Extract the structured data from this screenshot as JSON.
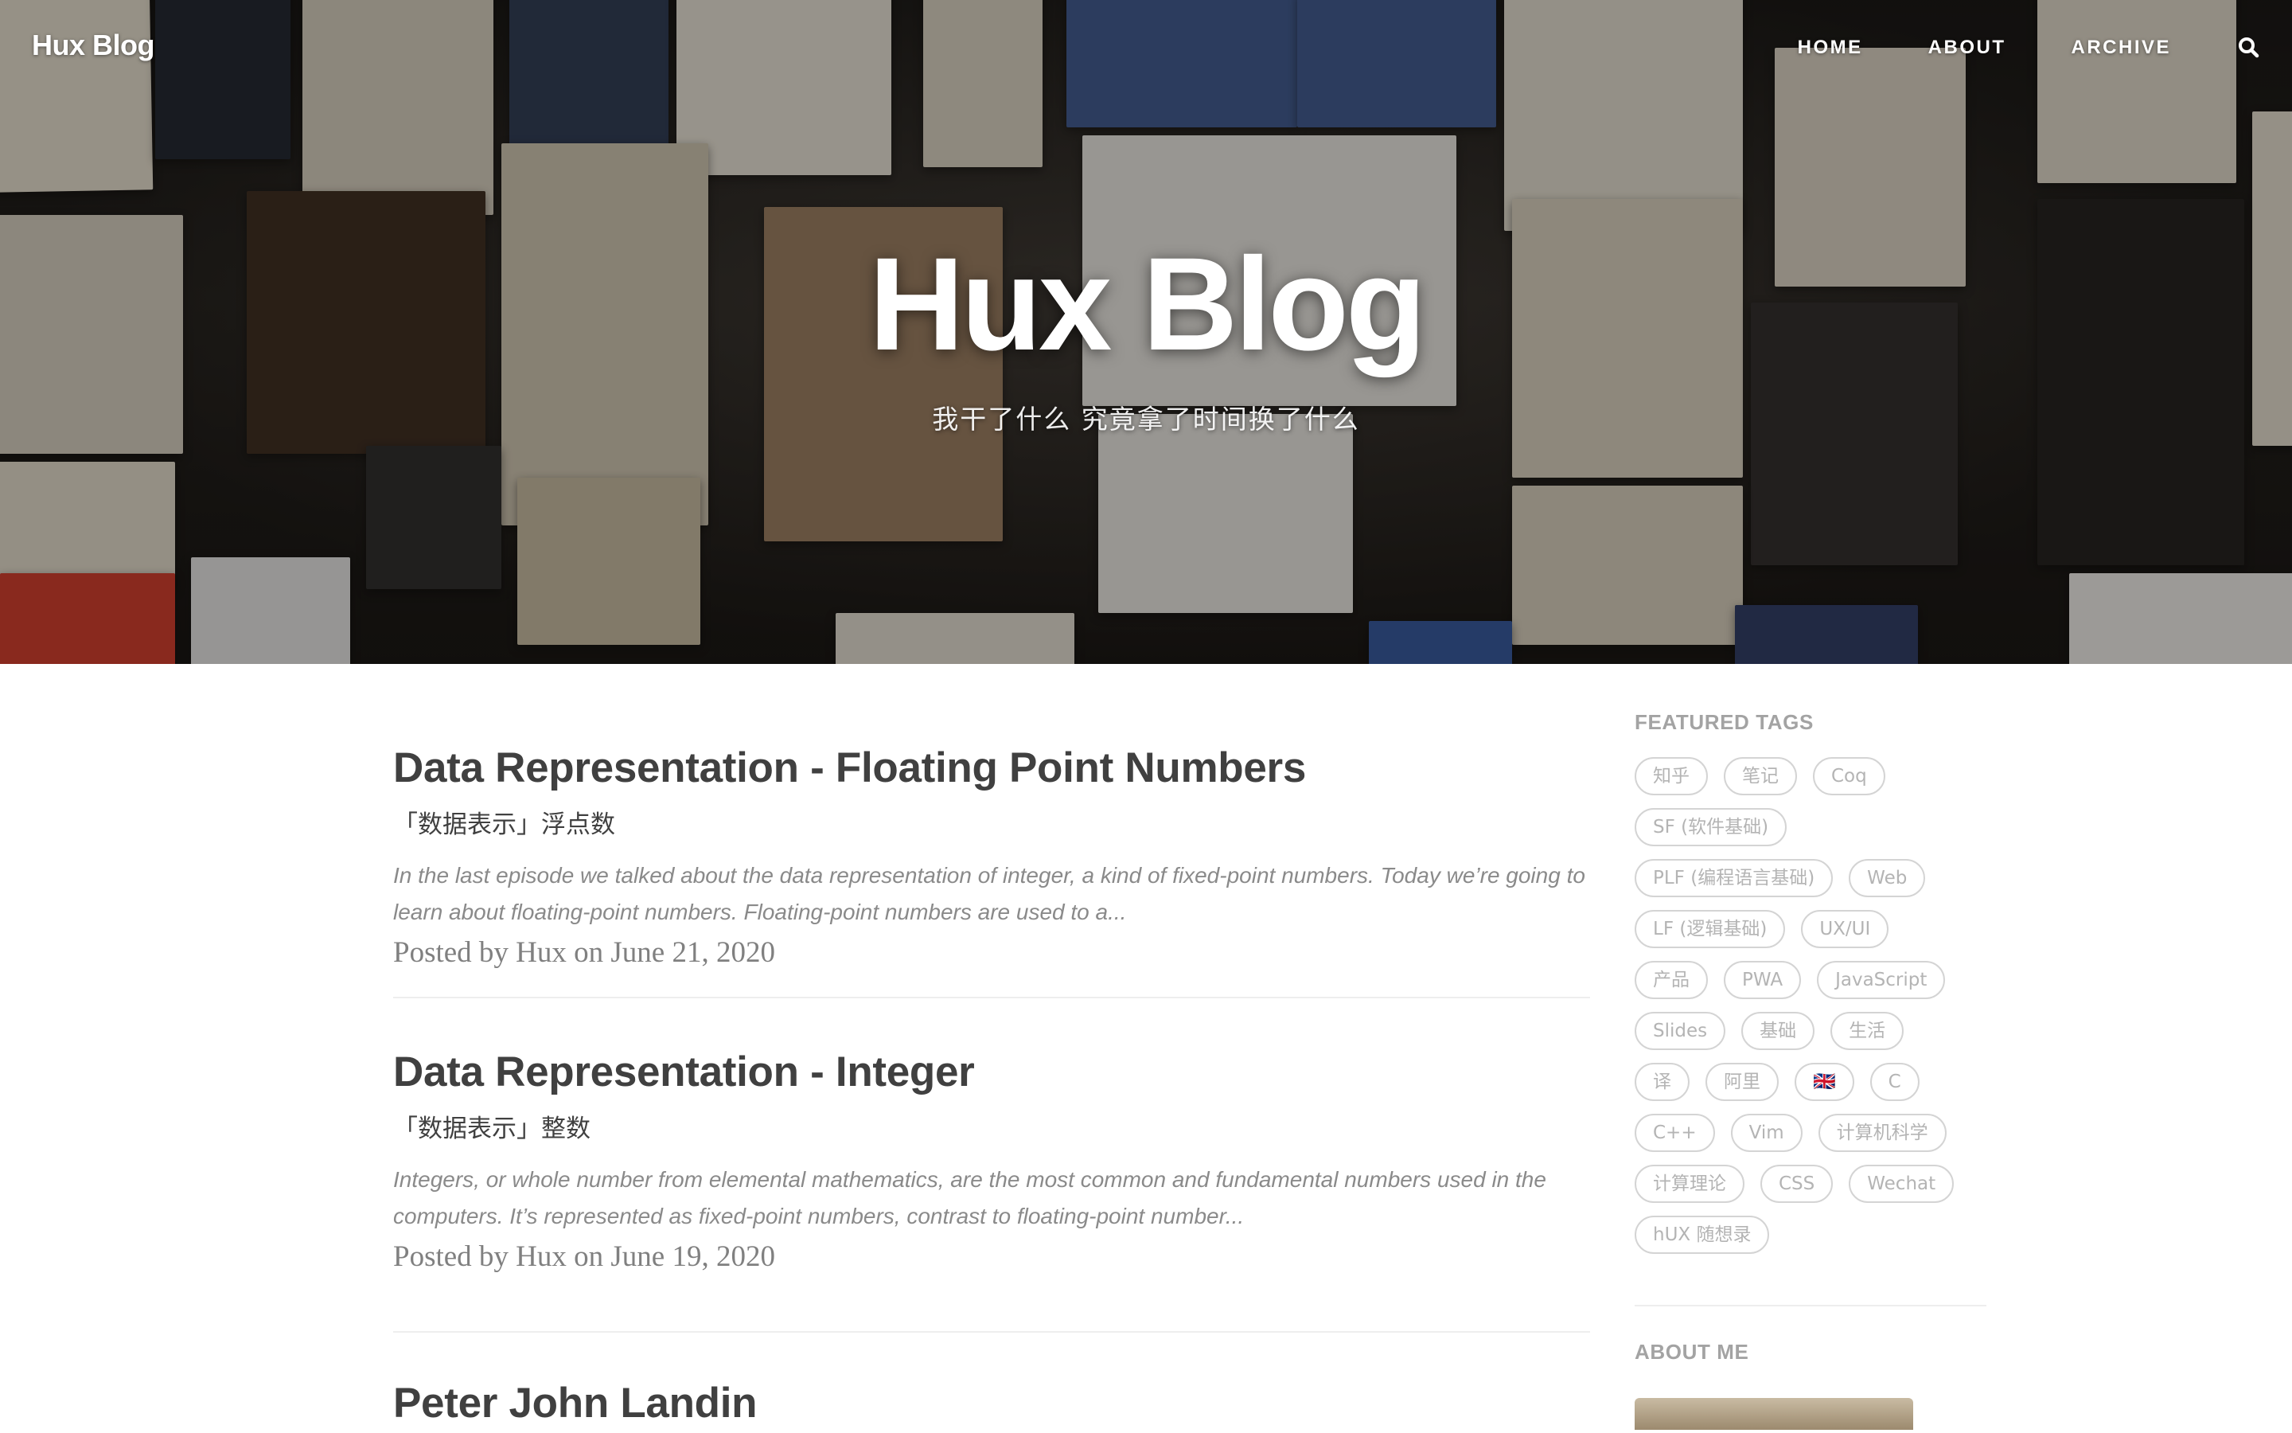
{
  "nav": {
    "brand": "Hux Blog",
    "links": [
      "HOME",
      "ABOUT",
      "ARCHIVE"
    ]
  },
  "hero": {
    "title": "Hux Blog",
    "subtitle": "我干了什么 究竟拿了时间换了什么"
  },
  "posts": [
    {
      "title": "Data Representation - Floating Point Numbers",
      "subtitle": "「数据表示」浮点数",
      "excerpt": "In the last episode we talked about the data representation of integer, a kind of fixed-point numbers. Today we’re going to learn about floating-point numbers. Floating-point numbers are used to a...",
      "meta": "Posted by Hux on June 21, 2020"
    },
    {
      "title": "Data Representation - Integer",
      "subtitle": "「数据表示」整数",
      "excerpt": "Integers, or whole number from elemental mathematics, are the most common and fundamental numbers used in the computers. It’s represented as fixed-point numbers, contrast to floating-point number...",
      "meta": "Posted by Hux on June 19, 2020"
    },
    {
      "title": "Peter John Landin"
    }
  ],
  "sidebar": {
    "featured_tags_heading": "FEATURED TAGS",
    "tags": [
      "知乎",
      "笔记",
      "Coq",
      "SF (软件基础)",
      "PLF (编程语言基础)",
      "Web",
      "LF (逻辑基础)",
      "UX/UI",
      "产品",
      "PWA",
      "JavaScript",
      "Slides",
      "基础",
      "生活",
      "译",
      "阿里",
      "🇬🇧",
      "C",
      "C++",
      "Vim",
      "计算机科学",
      "计算理论",
      "CSS",
      "Wechat",
      "hUX 随想录"
    ],
    "about_heading": "ABOUT ME"
  },
  "icons": {
    "search": "search-icon"
  },
  "colors": {
    "text": "#404040",
    "muted": "#808080",
    "tag_border": "#d4d4d4",
    "hero_text": "#ffffff"
  }
}
